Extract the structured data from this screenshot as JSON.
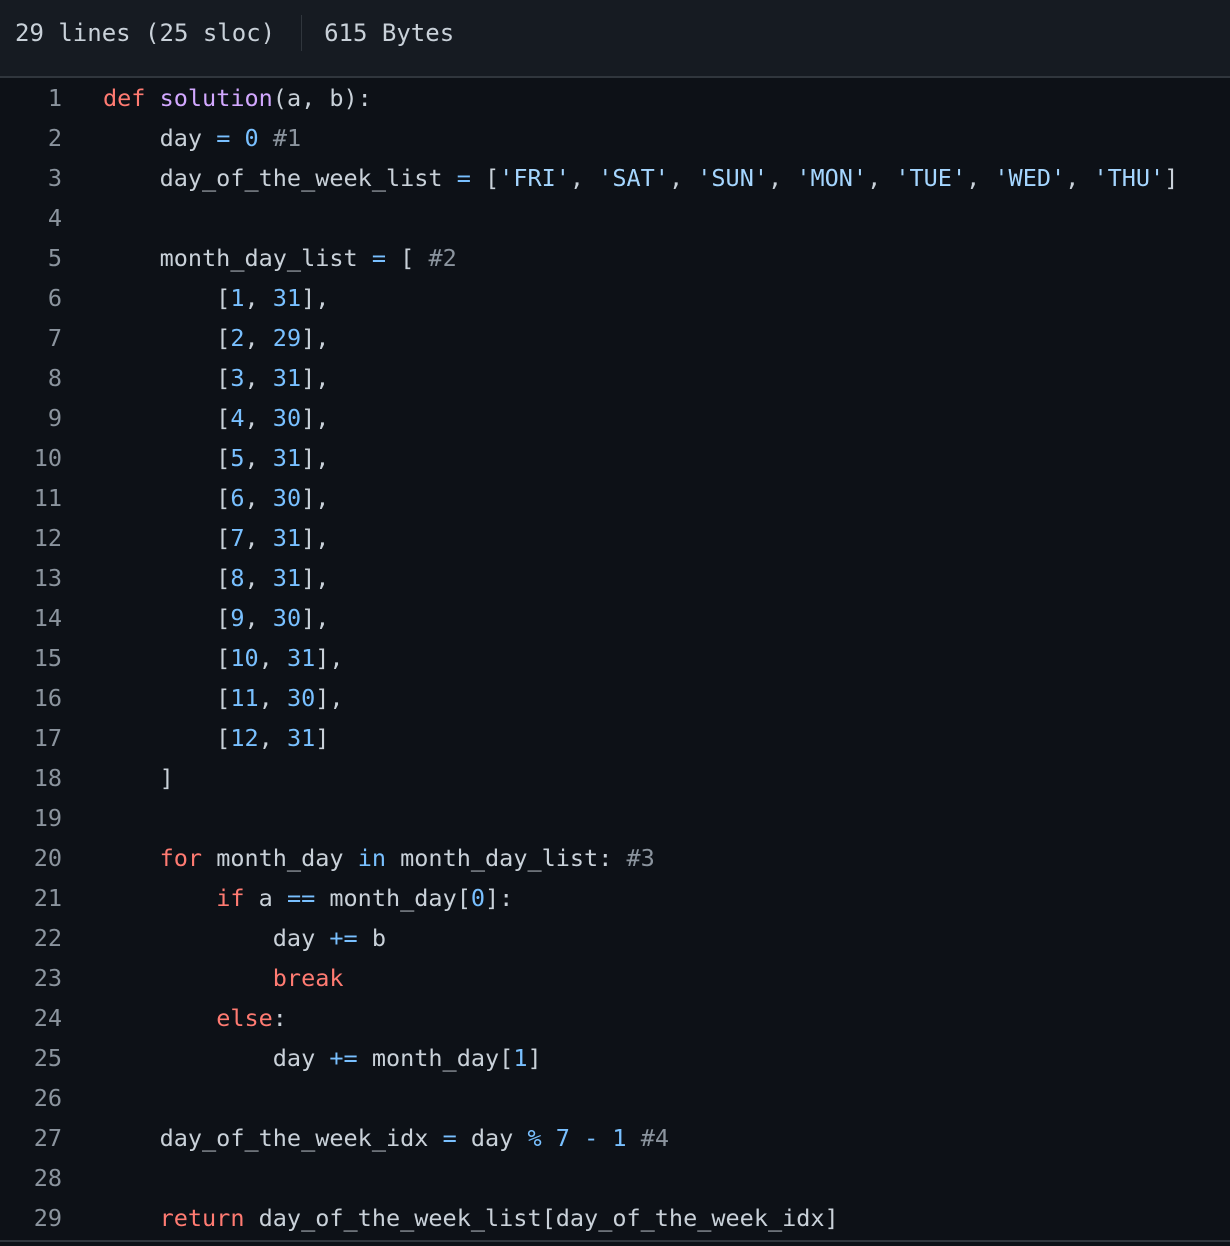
{
  "file_info": {
    "lines": "29 lines (25 sloc)",
    "size": "615 Bytes"
  },
  "colors": {
    "background": "#0d1117",
    "header_background": "#161b22",
    "keyword": "#ff7b72",
    "function": "#d2a8ff",
    "number": "#79c0ff",
    "string": "#a5d6ff",
    "comment": "#8b949e",
    "text": "#c9d1d9",
    "line_number": "#8b949e"
  },
  "code": [
    {
      "n": "1",
      "t": [
        [
          "k",
          "def"
        ],
        [
          "p",
          " "
        ],
        [
          "f",
          "solution"
        ],
        [
          "p",
          "(a, b):"
        ]
      ]
    },
    {
      "n": "2",
      "t": [
        [
          "p",
          "    day "
        ],
        [
          "o",
          "="
        ],
        [
          "p",
          " "
        ],
        [
          "n",
          "0"
        ],
        [
          "p",
          " "
        ],
        [
          "c",
          "#1"
        ]
      ]
    },
    {
      "n": "3",
      "t": [
        [
          "p",
          "    day_of_the_week_list "
        ],
        [
          "o",
          "="
        ],
        [
          "p",
          " ["
        ],
        [
          "s",
          "'FRI'"
        ],
        [
          "p",
          ", "
        ],
        [
          "s",
          "'SAT'"
        ],
        [
          "p",
          ", "
        ],
        [
          "s",
          "'SUN'"
        ],
        [
          "p",
          ", "
        ],
        [
          "s",
          "'MON'"
        ],
        [
          "p",
          ", "
        ],
        [
          "s",
          "'TUE'"
        ],
        [
          "p",
          ", "
        ],
        [
          "s",
          "'WED'"
        ],
        [
          "p",
          ", "
        ],
        [
          "s",
          "'THU'"
        ],
        [
          "p",
          "]"
        ]
      ]
    },
    {
      "n": "4",
      "t": []
    },
    {
      "n": "5",
      "t": [
        [
          "p",
          "    month_day_list "
        ],
        [
          "o",
          "="
        ],
        [
          "p",
          " [ "
        ],
        [
          "c",
          "#2"
        ]
      ]
    },
    {
      "n": "6",
      "t": [
        [
          "p",
          "        ["
        ],
        [
          "n",
          "1"
        ],
        [
          "p",
          ", "
        ],
        [
          "n",
          "31"
        ],
        [
          "p",
          "],"
        ]
      ]
    },
    {
      "n": "7",
      "t": [
        [
          "p",
          "        ["
        ],
        [
          "n",
          "2"
        ],
        [
          "p",
          ", "
        ],
        [
          "n",
          "29"
        ],
        [
          "p",
          "],"
        ]
      ]
    },
    {
      "n": "8",
      "t": [
        [
          "p",
          "        ["
        ],
        [
          "n",
          "3"
        ],
        [
          "p",
          ", "
        ],
        [
          "n",
          "31"
        ],
        [
          "p",
          "],"
        ]
      ]
    },
    {
      "n": "9",
      "t": [
        [
          "p",
          "        ["
        ],
        [
          "n",
          "4"
        ],
        [
          "p",
          ", "
        ],
        [
          "n",
          "30"
        ],
        [
          "p",
          "],"
        ]
      ]
    },
    {
      "n": "10",
      "t": [
        [
          "p",
          "        ["
        ],
        [
          "n",
          "5"
        ],
        [
          "p",
          ", "
        ],
        [
          "n",
          "31"
        ],
        [
          "p",
          "],"
        ]
      ]
    },
    {
      "n": "11",
      "t": [
        [
          "p",
          "        ["
        ],
        [
          "n",
          "6"
        ],
        [
          "p",
          ", "
        ],
        [
          "n",
          "30"
        ],
        [
          "p",
          "],"
        ]
      ]
    },
    {
      "n": "12",
      "t": [
        [
          "p",
          "        ["
        ],
        [
          "n",
          "7"
        ],
        [
          "p",
          ", "
        ],
        [
          "n",
          "31"
        ],
        [
          "p",
          "],"
        ]
      ]
    },
    {
      "n": "13",
      "t": [
        [
          "p",
          "        ["
        ],
        [
          "n",
          "8"
        ],
        [
          "p",
          ", "
        ],
        [
          "n",
          "31"
        ],
        [
          "p",
          "],"
        ]
      ]
    },
    {
      "n": "14",
      "t": [
        [
          "p",
          "        ["
        ],
        [
          "n",
          "9"
        ],
        [
          "p",
          ", "
        ],
        [
          "n",
          "30"
        ],
        [
          "p",
          "],"
        ]
      ]
    },
    {
      "n": "15",
      "t": [
        [
          "p",
          "        ["
        ],
        [
          "n",
          "10"
        ],
        [
          "p",
          ", "
        ],
        [
          "n",
          "31"
        ],
        [
          "p",
          "],"
        ]
      ]
    },
    {
      "n": "16",
      "t": [
        [
          "p",
          "        ["
        ],
        [
          "n",
          "11"
        ],
        [
          "p",
          ", "
        ],
        [
          "n",
          "30"
        ],
        [
          "p",
          "],"
        ]
      ]
    },
    {
      "n": "17",
      "t": [
        [
          "p",
          "        ["
        ],
        [
          "n",
          "12"
        ],
        [
          "p",
          ", "
        ],
        [
          "n",
          "31"
        ],
        [
          "p",
          "]"
        ]
      ]
    },
    {
      "n": "18",
      "t": [
        [
          "p",
          "    ]"
        ]
      ]
    },
    {
      "n": "19",
      "t": []
    },
    {
      "n": "20",
      "t": [
        [
          "p",
          "    "
        ],
        [
          "k",
          "for"
        ],
        [
          "p",
          " month_day "
        ],
        [
          "o",
          "in"
        ],
        [
          "p",
          " month_day_list: "
        ],
        [
          "c",
          "#3"
        ]
      ]
    },
    {
      "n": "21",
      "t": [
        [
          "p",
          "        "
        ],
        [
          "k",
          "if"
        ],
        [
          "p",
          " a "
        ],
        [
          "o",
          "=="
        ],
        [
          "p",
          " month_day["
        ],
        [
          "n",
          "0"
        ],
        [
          "p",
          "]:"
        ]
      ]
    },
    {
      "n": "22",
      "t": [
        [
          "p",
          "            day "
        ],
        [
          "o",
          "+="
        ],
        [
          "p",
          " b"
        ]
      ]
    },
    {
      "n": "23",
      "t": [
        [
          "p",
          "            "
        ],
        [
          "k",
          "break"
        ]
      ]
    },
    {
      "n": "24",
      "t": [
        [
          "p",
          "        "
        ],
        [
          "k",
          "else"
        ],
        [
          "p",
          ":"
        ]
      ]
    },
    {
      "n": "25",
      "t": [
        [
          "p",
          "            day "
        ],
        [
          "o",
          "+="
        ],
        [
          "p",
          " month_day["
        ],
        [
          "n",
          "1"
        ],
        [
          "p",
          "]"
        ]
      ]
    },
    {
      "n": "26",
      "t": []
    },
    {
      "n": "27",
      "t": [
        [
          "p",
          "    day_of_the_week_idx "
        ],
        [
          "o",
          "="
        ],
        [
          "p",
          " day "
        ],
        [
          "o",
          "%"
        ],
        [
          "p",
          " "
        ],
        [
          "n",
          "7"
        ],
        [
          "p",
          " "
        ],
        [
          "o",
          "-"
        ],
        [
          "p",
          " "
        ],
        [
          "n",
          "1"
        ],
        [
          "p",
          " "
        ],
        [
          "c",
          "#4"
        ]
      ]
    },
    {
      "n": "28",
      "t": []
    },
    {
      "n": "29",
      "t": [
        [
          "p",
          "    "
        ],
        [
          "k",
          "return"
        ],
        [
          "p",
          " day_of_the_week_list[day_of_the_week_idx]"
        ]
      ]
    }
  ]
}
